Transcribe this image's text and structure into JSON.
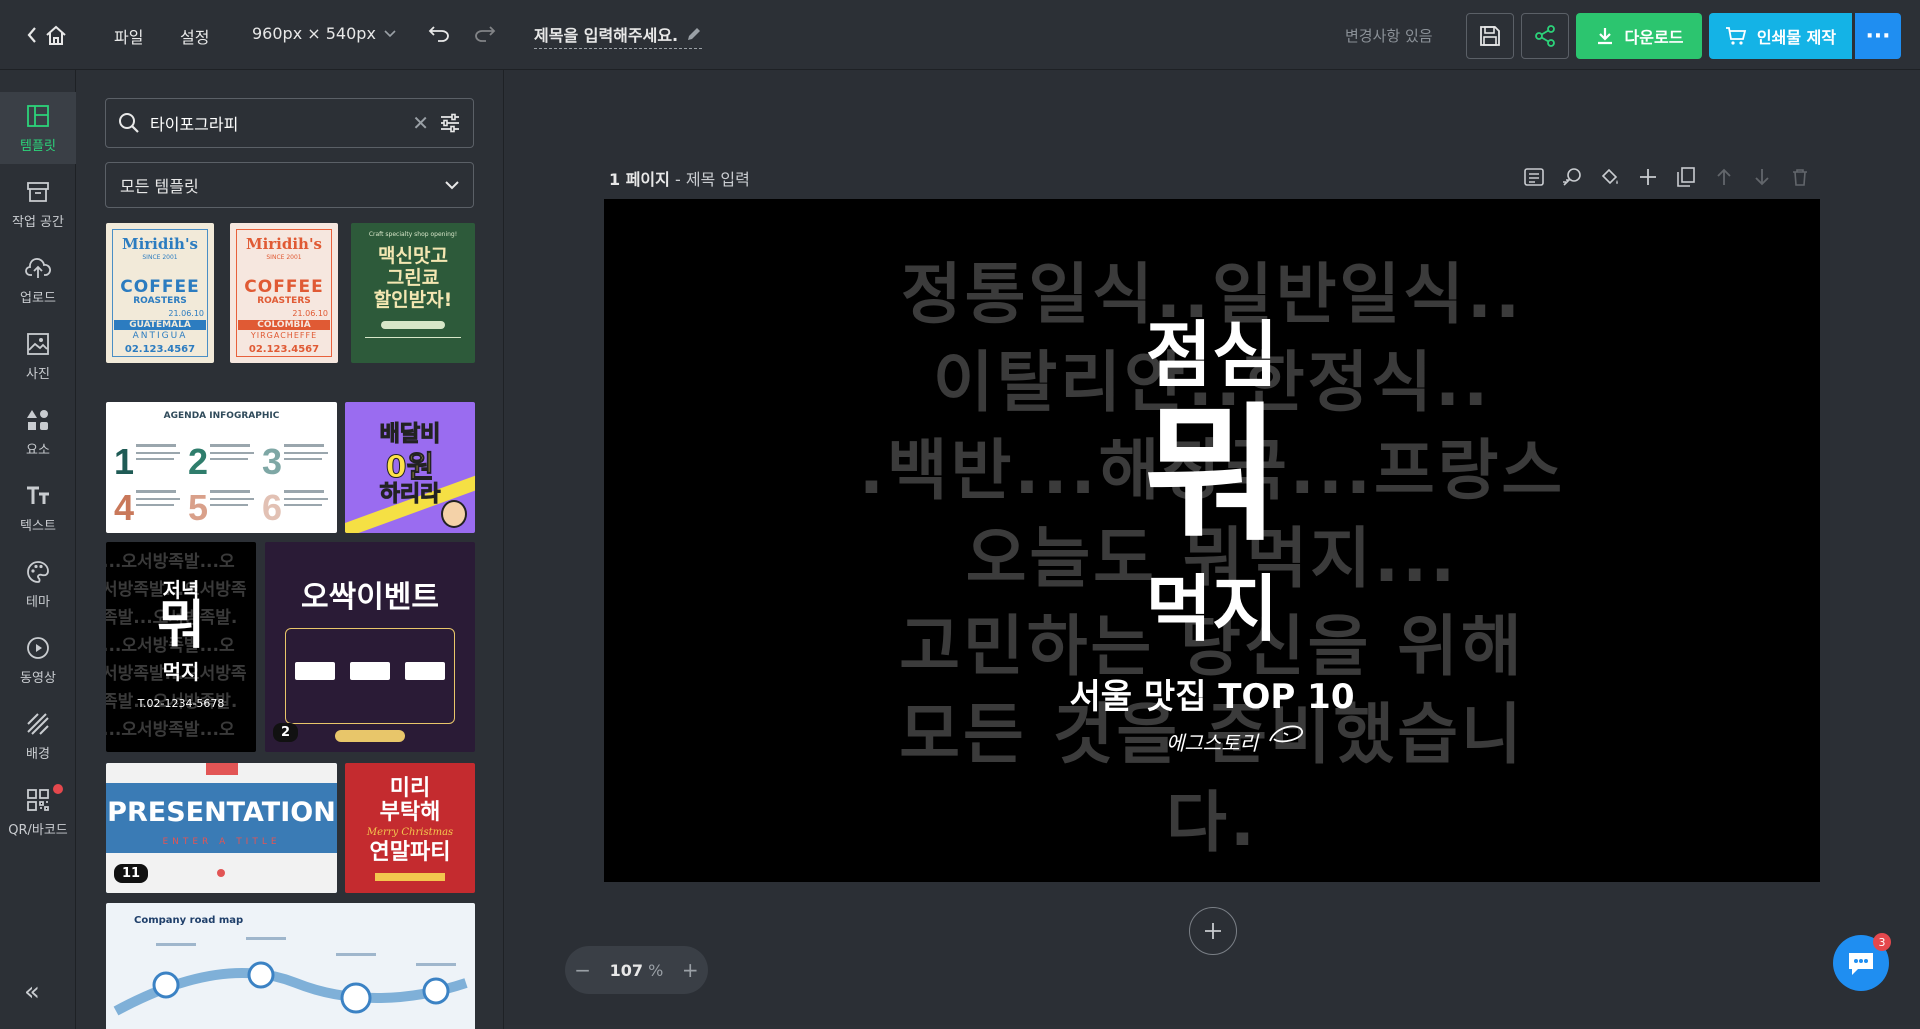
{
  "header": {
    "file_menu": "파일",
    "settings_menu": "설정",
    "canvas_size": "960px × 540px",
    "doc_title": "제목을 입력해주세요.",
    "changes_status": "변경사항 있음",
    "download_label": "다운로드",
    "print_label": "인쇄물 제작",
    "more_label": "···"
  },
  "rail": {
    "items": [
      {
        "label": "템플릿",
        "icon": "layout-icon"
      },
      {
        "label": "작업 공간",
        "icon": "archive-icon"
      },
      {
        "label": "업로드",
        "icon": "cloud-upload-icon"
      },
      {
        "label": "사진",
        "icon": "image-icon"
      },
      {
        "label": "요소",
        "icon": "shapes-icon"
      },
      {
        "label": "텍스트",
        "icon": "text-icon"
      },
      {
        "label": "테마",
        "icon": "palette-icon"
      },
      {
        "label": "동영상",
        "icon": "play-icon"
      },
      {
        "label": "배경",
        "icon": "stripes-icon"
      },
      {
        "label": "QR/바코드",
        "icon": "qr-icon"
      }
    ],
    "collapse": "«"
  },
  "panel": {
    "search_value": "타이포그라피",
    "filter_label": "모든 템플릿",
    "thumbs": {
      "t1": {
        "brand": "Miridih's",
        "since": "SINCE 2001",
        "line1": "COFFEE",
        "line2": "ROASTERS",
        "date": "21.06.10",
        "origin": "GUATEMALA",
        "region": "ANTIGUA",
        "phone": "02.123.4567"
      },
      "t2": {
        "brand": "Miridih's",
        "since": "SINCE 2001",
        "line1": "COFFEE",
        "line2": "ROASTERS",
        "date": "21.06.10",
        "origin": "COLOMBIA",
        "region": "YIRGACHEFFE",
        "phone": "02.123.4567"
      },
      "t3": {
        "top": "Craft specialty shop opening!",
        "line1": "맥신맛고",
        "line2": "그린쿄",
        "line3": "할인받자!"
      },
      "t4": {
        "title": "AGENDA INFOGRAPHIC"
      },
      "t5": {
        "line1": "배달비",
        "line2": "0원",
        "line3": "하리라"
      },
      "t6": {
        "line1": "저녁",
        "line2": "뭐",
        "line3": "먹지",
        "phone": "T.02-1234-5678"
      },
      "t7": {
        "title": "오싹이벤트",
        "badge": "2"
      },
      "t8": {
        "title": "PRESENTATION",
        "subtitle": "ENTER A TITLE",
        "badge": "11"
      },
      "t9": {
        "line1": "미리",
        "line2": "부탁해",
        "line3": "Merry Christmas",
        "line4": "연말파티"
      },
      "t10": {
        "title": "Company road map"
      }
    }
  },
  "canvas": {
    "page_label_bold": "1 페이지",
    "page_label_rest": " - 제목 입력",
    "bg_lines": [
      "정통일식..일반일식..",
      "이탈리안..한정식..",
      ".백반...해장국...프랑스",
      "오늘도 뭐먹지...",
      "고민하는 당신을 위해",
      "모든 것을 준비했습니",
      "다."
    ],
    "title_top": "점심",
    "title_big": "뭐",
    "title_bottom": "먹지",
    "subtitle": "서울 맛집 TOP 10",
    "signature": "에그스토리"
  },
  "zoom": {
    "value": "107",
    "unit": "%"
  },
  "chat": {
    "count": "3"
  }
}
